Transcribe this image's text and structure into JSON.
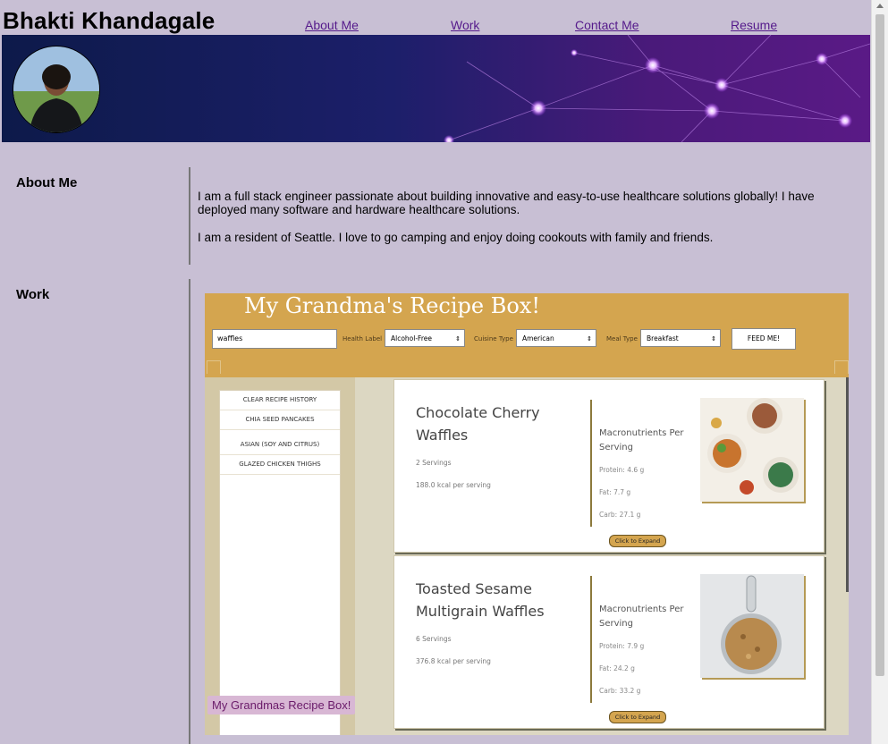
{
  "header": {
    "site_title": "Bhakti Khandagale",
    "nav": [
      "About Me",
      "Work",
      "Contact Me",
      "Resume"
    ]
  },
  "about": {
    "heading": "About Me",
    "paragraphs": [
      "I am a full stack engineer passionate about building innovative and easy-to-use healthcare solutions globally! I have deployed many software and hardware healthcare solutions.",
      "I am a resident of Seattle. I love to go camping and enjoy doing cookouts with family and friends."
    ]
  },
  "work": {
    "heading": "Work",
    "project_caption": "My Grandmas Recipe Box!",
    "app": {
      "title": "My Grandma's Recipe Box!",
      "search_value": "waffles",
      "health_label": "Health Label",
      "health_value": "Alcohol-Free",
      "cuisine_label": "Cuisine Type",
      "cuisine_value": "American",
      "meal_label": "Meal Type",
      "meal_value": "Breakfast",
      "submit_label": "FEED ME!",
      "history": [
        "CLEAR RECIPE HISTORY",
        "CHIA SEED PANCAKES",
        "ASIAN (SOY AND CITRUS)",
        "GLAZED CHICKEN THIGHS"
      ],
      "recipes": [
        {
          "name": "Chocolate Cherry Waffles",
          "servings": "2 Servings",
          "kcal": "188.0 kcal per serving",
          "macro_heading": "Macronutrients Per Serving",
          "protein": "Protein: 4.6 g",
          "fat": "Fat: 7.7 g",
          "carb": "Carb: 27.1 g",
          "expand_label": "Click to Expand"
        },
        {
          "name": "Toasted Sesame Multigrain Waffles",
          "servings": "6 Servings",
          "kcal": "376.8 kcal per serving",
          "macro_heading": "Macronutrients Per Serving",
          "protein": "Protein: 7.9 g",
          "fat": "Fat: 24.2 g",
          "carb": "Carb: 33.2 g",
          "expand_label": "Click to Expand"
        }
      ]
    }
  },
  "colors": {
    "page_background": "#c8bfd4",
    "link": "#551a8b",
    "app_header": "#d4a54f"
  }
}
